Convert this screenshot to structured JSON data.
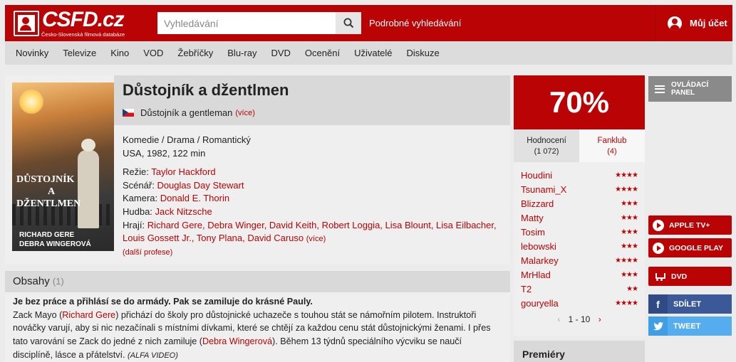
{
  "header": {
    "logo_text": "CSFD.cz",
    "logo_subtitle": "Česko-Slovenská filmová databáze",
    "search_placeholder": "Vyhledávání",
    "advanced_search": "Podrobné vyhledávání",
    "account": "Můj účet",
    "accent_color": "#ba0305"
  },
  "nav": {
    "items": [
      "Novinky",
      "Televize",
      "Kino",
      "VOD",
      "Žebříčky",
      "Blu-ray",
      "DVD",
      "Ocenění",
      "Uživatelé",
      "Diskuze"
    ]
  },
  "film": {
    "title": "Důstojník a džentlmen",
    "original_title": "Důstojník a gentleman",
    "more": "(více)",
    "genres": "Komedie / Drama / Romantický",
    "origin": "USA, 1982, 122 min",
    "director_label": "Režie:",
    "director": "Taylor Hackford",
    "writer_label": "Scénář:",
    "writer": "Douglas Day Stewart",
    "camera_label": "Kamera:",
    "camera": "Donald E. Thorin",
    "music_label": "Hudba:",
    "music": "Jack Nitzsche",
    "cast_label": "Hrají:",
    "cast_line1": "Richard Gere, Debra Winger, David Keith, Robert Loggia, Lisa Blount, Lisa Eilbacher,",
    "cast_line2": "Louis Gossett Jr., Tony Plana, David Caruso",
    "cast_more": "(více)",
    "more_professions": "(další profese)",
    "poster": {
      "title_line1": "DŮSTOJNÍK",
      "title_line2": "A",
      "title_line3": "DŽENTLMEN",
      "cast_line1": "RICHARD GERE",
      "cast_line2": "DEBRA WINGEROVÁ"
    }
  },
  "content": {
    "heading": "Obsahy",
    "count": "(1)",
    "lead": "Je bez práce a přihlásí se do armády. Pak se zamiluje do krásné Pauly.",
    "t1": "Zack Mayo (",
    "link1": "Richard Gere",
    "t2": ") přichází do školy pro důstojnické uchazeče s touhou stát se námořním pilotem. Instruktoři nováčky varují, aby si nic nezačínali s místními dívkami, které se chtějí za každou cenu stát důstojnickými ženami. I přes tato varování se Zack do jedné z nich zamiluje (",
    "link2": "Debra Wingerová",
    "t3": "). Během 13 týdnů speciálního výcviku se naučí disciplíně, lásce a přátelství.",
    "source": "(ALFA VIDEO)"
  },
  "rating": {
    "percent": "70%",
    "tab_ratings_label": "Hodnocení",
    "tab_ratings_count": "(1 072)",
    "tab_fanclub_label": "Fanklub",
    "tab_fanclub_count": "(4)",
    "users": [
      {
        "name": "Houdini",
        "stars": "★★★★"
      },
      {
        "name": "Tsunami_X",
        "stars": "★★★★"
      },
      {
        "name": "Blizzard",
        "stars": "★★★"
      },
      {
        "name": "Matty",
        "stars": "★★★"
      },
      {
        "name": "Tosim",
        "stars": "★★★"
      },
      {
        "name": "lebowski",
        "stars": "★★★"
      },
      {
        "name": "Malarkey",
        "stars": "★★★★"
      },
      {
        "name": "MrHlad",
        "stars": "★★★"
      },
      {
        "name": "T2",
        "stars": "★★"
      },
      {
        "name": "gouryella",
        "stars": "★★★★"
      }
    ],
    "pager": "1 - 10"
  },
  "premiery": "Premiéry",
  "sidebar": {
    "control_panel_line1": "OVLÁDACÍ",
    "control_panel_line2": "PANEL",
    "apple_tv": "APPLE TV+",
    "google_play": "GOOGLE PLAY",
    "dvd": "DVD",
    "share": "SDÍLET",
    "tweet": "TWEET",
    "facebook_color": "#3b5998",
    "twitter_color": "#55acee"
  }
}
